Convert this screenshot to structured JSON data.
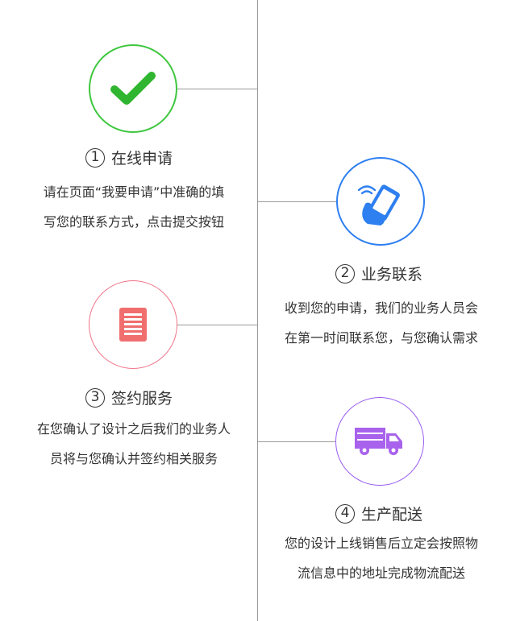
{
  "colors": {
    "axis": "#9a9a9a",
    "step1_ring": "#3ec73e",
    "step1_icon": "#2fb52f",
    "step2_ring": "#2e7ff0",
    "step2_icon": "#2e7ff0",
    "step3_ring": "#f0758a",
    "step3_icon": "#f06e6e",
    "step4_ring": "#9a5cf0",
    "step4_icon": "#a862ec"
  },
  "steps": [
    {
      "number": "1",
      "title": "在线申请",
      "icon": "checkmark-icon",
      "desc_line1": "请在页面“我要申请”中准确的填",
      "desc_line2": "写您的联系方式，点击提交按钮"
    },
    {
      "number": "2",
      "title": "业务联系",
      "icon": "phone-in-hand-icon",
      "desc_line1": "收到您的申请，我们的业务人员会",
      "desc_line2": "在第一时间联系您，与您确认需求"
    },
    {
      "number": "3",
      "title": "签约服务",
      "icon": "document-icon",
      "desc_line1": "在您确认了设计之后我们的业务人",
      "desc_line2": "员将与您确认并签约相关服务"
    },
    {
      "number": "4",
      "title": "生产配送",
      "icon": "delivery-truck-icon",
      "desc_line1": "您的设计上线销售后立定会按照物",
      "desc_line2": "流信息中的地址完成物流配送"
    }
  ]
}
